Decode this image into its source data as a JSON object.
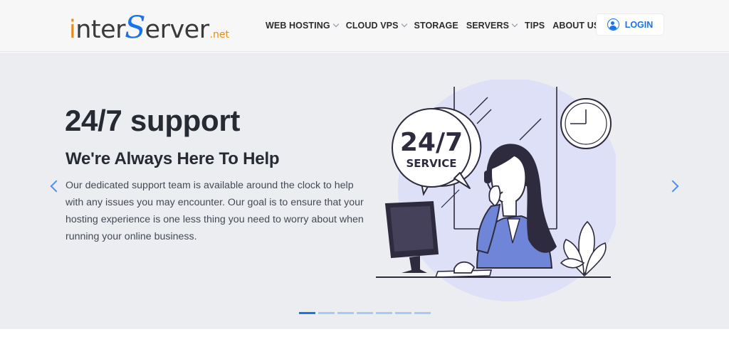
{
  "logo": {
    "part_i": "i",
    "part_nter": "nter",
    "part_s": "S",
    "part_erver": "erver",
    "part_net": ".net"
  },
  "nav": [
    {
      "label": "WEB HOSTING",
      "dropdown": true
    },
    {
      "label": "CLOUD VPS",
      "dropdown": true
    },
    {
      "label": "STORAGE",
      "dropdown": false
    },
    {
      "label": "SERVERS",
      "dropdown": true
    },
    {
      "label": "TIPS",
      "dropdown": false
    },
    {
      "label": "ABOUT US",
      "dropdown": true
    }
  ],
  "login_label": "LOGIN",
  "hero": {
    "title": "24/7 support",
    "subtitle": "We're Always Here To Help",
    "paragraph": "Our dedicated support team is available around the clock to help with any issues you may encounter. Our goal is to ensure that your hosting experience is one less thing you need to worry about when running your online business."
  },
  "illustration": {
    "bubble_line1": "24/7",
    "bubble_line2": "SERVICE"
  },
  "carousel": {
    "slide_count": 7,
    "active_index": 0
  },
  "colors": {
    "brand_blue": "#1a73e8",
    "brand_orange": "#e88a19",
    "hero_bg": "#ecedf1"
  },
  "icons": {
    "login": "user-circle-icon",
    "prev": "chevron-left-icon",
    "next": "chevron-right-icon",
    "dropdown": "chevron-down-icon"
  }
}
